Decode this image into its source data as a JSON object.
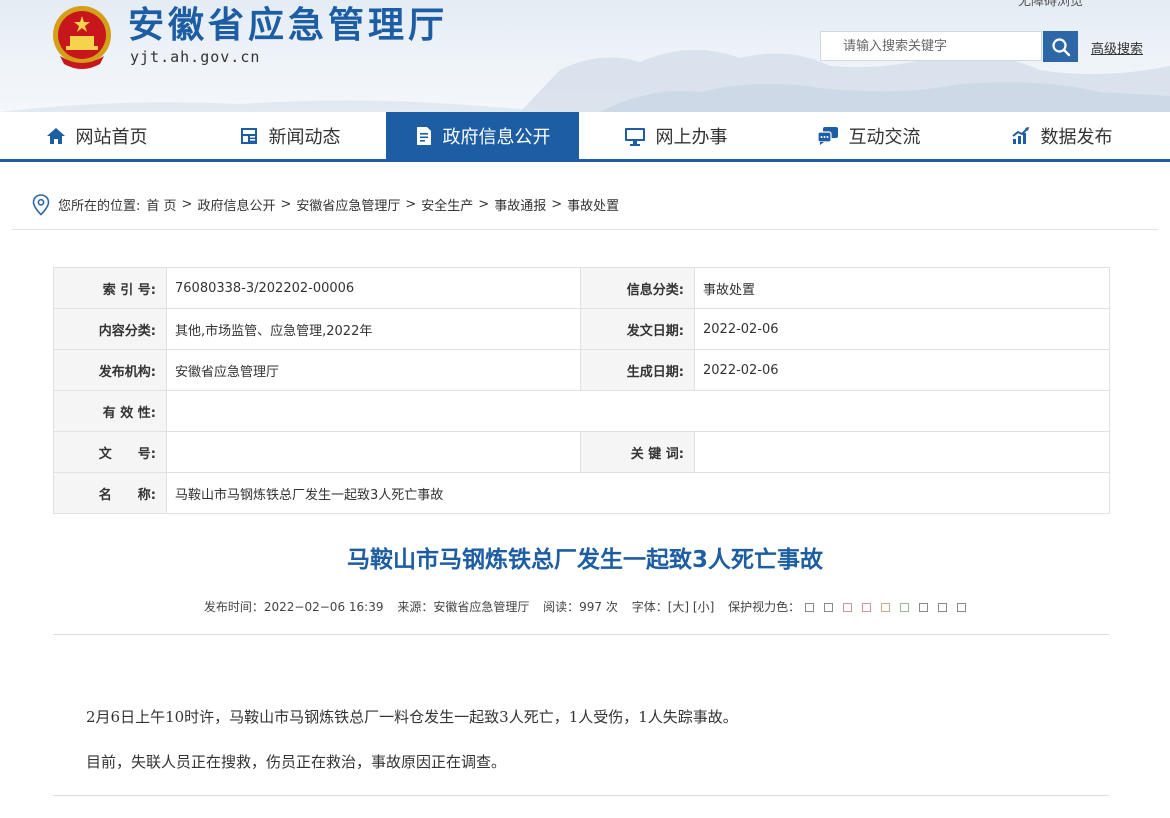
{
  "header": {
    "site_name": "安徽省应急管理厅",
    "domain": "yjt.ah.gov.cn",
    "top_link": "无障碍浏览",
    "search_placeholder": "请输入搜索关键字",
    "advanced_search": "高级搜索"
  },
  "nav": {
    "items": [
      {
        "label": "网站首页",
        "icon": "home-icon"
      },
      {
        "label": "新闻动态",
        "icon": "news-icon"
      },
      {
        "label": "政府信息公开",
        "icon": "document-icon",
        "active": true
      },
      {
        "label": "网上办事",
        "icon": "monitor-icon"
      },
      {
        "label": "互动交流",
        "icon": "chat-icon"
      },
      {
        "label": "数据发布",
        "icon": "chart-icon"
      }
    ],
    "accent_color": "#1d5da3"
  },
  "breadcrumb": {
    "prefix": "您所在的位置:",
    "items": [
      "首 页",
      "政府信息公开",
      "安徽省应急管理厅",
      "安全生产",
      "事故通报",
      "事故处置"
    ]
  },
  "info": {
    "index_label": "索 引 号:",
    "index_value": "76080338-3/202202-00006",
    "category_label": "信息分类:",
    "category_value": "事故处置",
    "content_label": "内容分类:",
    "content_value": "其他,市场监管、应急管理,2022年",
    "issue_date_label": "发文日期:",
    "issue_date_value": "2022-02-06",
    "org_label": "发布机构:",
    "org_value": "安徽省应急管理厅",
    "gen_date_label": "生成日期:",
    "gen_date_value": "2022-02-06",
    "validity_label": "有 效 性:",
    "validity_value": "",
    "doc_no_label": "文　　号:",
    "doc_no_value": "",
    "keywords_label": "关 键 词:",
    "keywords_value": "",
    "name_label": "名　　称:",
    "name_value": "马鞍山市马钢炼铁总厂发生一起致3人死亡事故"
  },
  "article": {
    "title": "马鞍山市马钢炼铁总厂发生一起致3人死亡事故",
    "publish_time": "发布时间：2022−02−06 16:39",
    "source": "来源：安徽省应急管理厅",
    "views": "阅读：997 次",
    "font_size": "字体：[大] [小]",
    "eye_color": "保护视力色：",
    "paragraphs": [
      "2月6日上午10时许，马鞍山市马钢炼铁总厂一料仓发生一起致3人死亡，1人受伤，1人失踪事故。",
      "目前，失联人员正在搜救，伤员正在救治，事故原因正在调查。"
    ]
  }
}
